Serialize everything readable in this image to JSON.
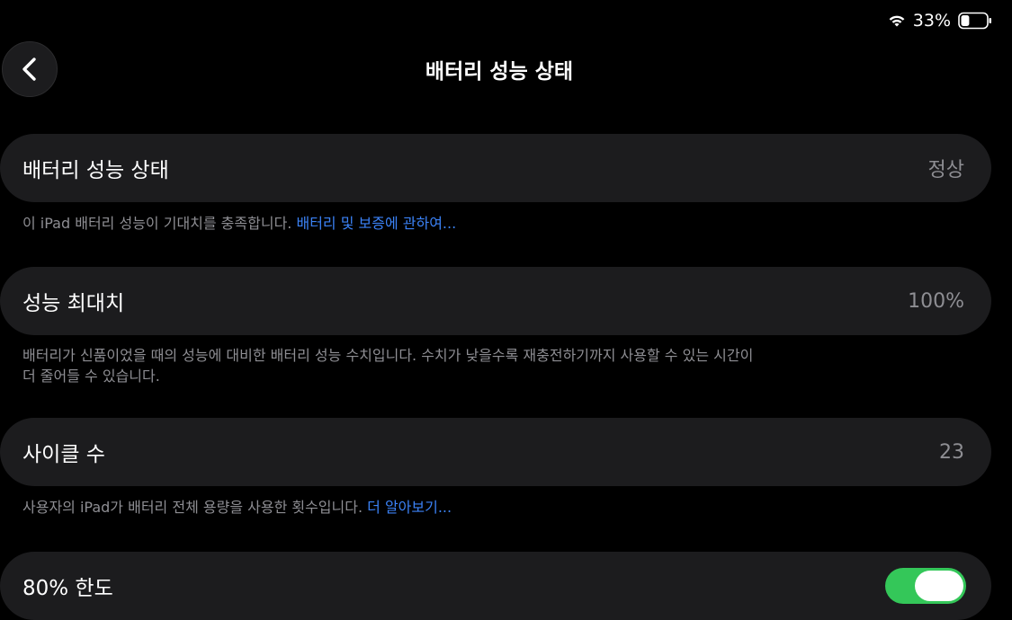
{
  "status_bar": {
    "battery_percent": "33%",
    "battery_level": 0.33
  },
  "header": {
    "title": "배터리 성능 상태",
    "back_icon": "chevron-left-icon"
  },
  "rows": {
    "health": {
      "label": "배터리 성능 상태",
      "value": "정상",
      "footnote": "이 iPad 배터리 성능이 기대치를 충족합니다. ",
      "footnote_link": "배터리 및 보증에 관하여..."
    },
    "max_capacity": {
      "label": "성능 최대치",
      "value": "100%",
      "footnote_line1": "배터리가 신품이었을 때의 성능에 대비한 배터리 성능 수치입니다. 수치가 낮을수록 재충전하기까지 사용할 수 있는 시간이",
      "footnote_line2": "더 줄어들 수 있습니다."
    },
    "cycle_count": {
      "label": "사이클 수",
      "value": "23",
      "footnote": "사용자의 iPad가 배터리 전체 용량을 사용한 횟수입니다. ",
      "footnote_link": "더 알아보기..."
    },
    "limit_80": {
      "label": "80% 한도",
      "toggle_on": true
    }
  },
  "colors": {
    "background": "#000000",
    "cell": "#1c1c1e",
    "secondary_text": "#8e8e93",
    "link": "#3b82f6",
    "toggle_on": "#34c759"
  }
}
